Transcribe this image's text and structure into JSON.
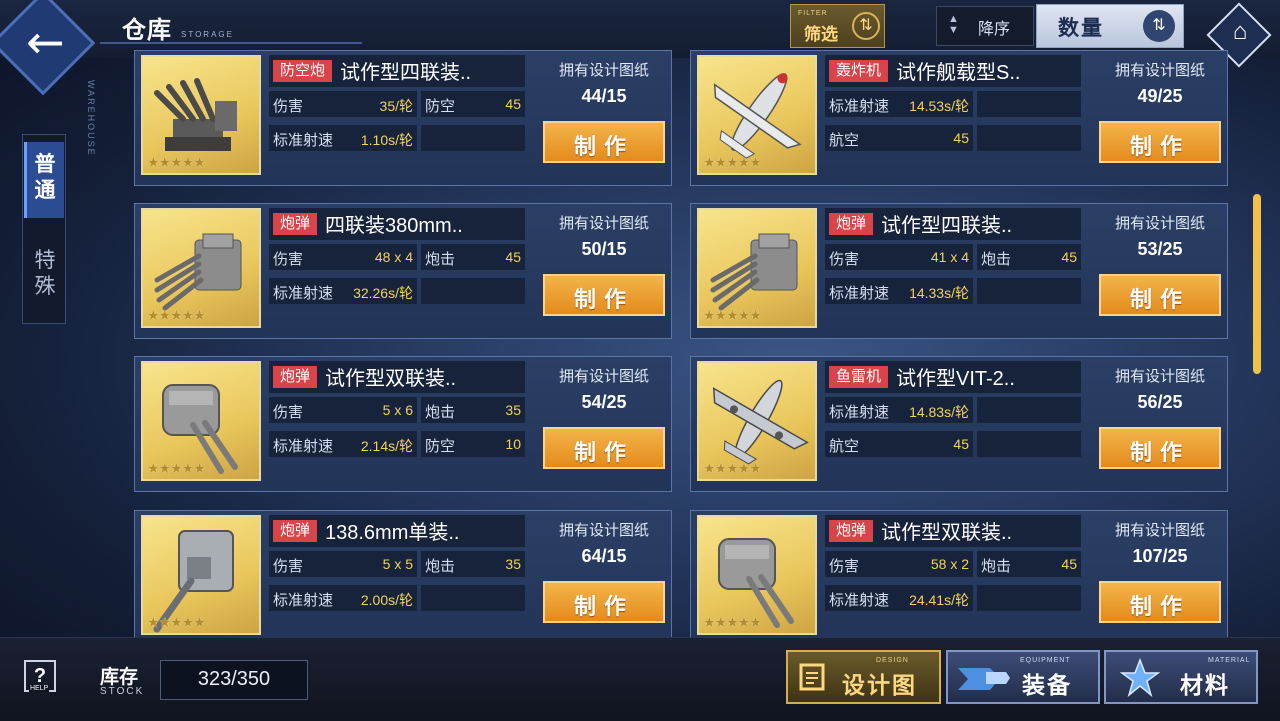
{
  "header": {
    "title": "仓库",
    "subtitle": "STORAGE",
    "filter": {
      "label": "筛选",
      "label_en": "FILTER"
    },
    "sort_order": "降序",
    "sort_field": "数量"
  },
  "sidebar": {
    "vertical_label": "WAREHOUSE",
    "tabs": [
      {
        "label": "普通",
        "selected": true
      },
      {
        "label": "特殊",
        "selected": false
      }
    ]
  },
  "bp_label": "拥有设计图纸",
  "make_label": "制作",
  "cards": [
    {
      "tag": "防空炮",
      "name": "试作型四联装..",
      "stars": "★★★★★",
      "icon": "aa-gun-icon",
      "stats": [
        {
          "label": "伤害",
          "value": "35/轮"
        },
        {
          "label": "防空",
          "value": "45"
        },
        {
          "label": "标准射速",
          "value": "1.10s/轮"
        },
        {
          "label": "",
          "value": ""
        }
      ],
      "blueprints": "44/15"
    },
    {
      "tag": "轰炸机",
      "name": "试作舰载型S..",
      "stars": "★★★★★",
      "icon": "bomber-plane-icon",
      "stats": [
        {
          "label": "标准射速",
          "value": "14.53s/轮"
        },
        {
          "label": "",
          "value": ""
        },
        {
          "label": "航空",
          "value": "45"
        },
        {
          "label": "",
          "value": ""
        }
      ],
      "blueprints": "49/25"
    },
    {
      "tag": "炮弹",
      "name": "四联装380mm..",
      "stars": "★★★★★",
      "icon": "quad-turret-icon",
      "stats": [
        {
          "label": "伤害",
          "value": "48 x 4"
        },
        {
          "label": "炮击",
          "value": "45"
        },
        {
          "label": "标准射速",
          "value": "32.26s/轮"
        },
        {
          "label": "",
          "value": ""
        }
      ],
      "blueprints": "50/15"
    },
    {
      "tag": "炮弹",
      "name": "试作型四联装..",
      "stars": "★★★★★",
      "icon": "quad-turret-icon",
      "stats": [
        {
          "label": "伤害",
          "value": "41 x 4"
        },
        {
          "label": "炮击",
          "value": "45"
        },
        {
          "label": "标准射速",
          "value": "14.33s/轮"
        },
        {
          "label": "",
          "value": ""
        }
      ],
      "blueprints": "53/25"
    },
    {
      "tag": "炮弹",
      "name": "试作型双联装..",
      "stars": "★★★★★",
      "icon": "twin-turret-icon",
      "stats": [
        {
          "label": "伤害",
          "value": "5 x 6"
        },
        {
          "label": "炮击",
          "value": "35"
        },
        {
          "label": "标准射速",
          "value": "2.14s/轮"
        },
        {
          "label": "防空",
          "value": "10"
        }
      ],
      "blueprints": "54/25"
    },
    {
      "tag": "鱼雷机",
      "name": "试作型VIT-2..",
      "stars": "★★★★★",
      "icon": "torpedo-plane-icon",
      "stats": [
        {
          "label": "标准射速",
          "value": "14.83s/轮"
        },
        {
          "label": "",
          "value": ""
        },
        {
          "label": "航空",
          "value": "45"
        },
        {
          "label": "",
          "value": ""
        }
      ],
      "blueprints": "56/25"
    },
    {
      "tag": "炮弹",
      "name": "138.6mm单装..",
      "stars": "★★★★★",
      "icon": "single-turret-icon",
      "stats": [
        {
          "label": "伤害",
          "value": "5 x 5"
        },
        {
          "label": "炮击",
          "value": "35"
        },
        {
          "label": "标准射速",
          "value": "2.00s/轮"
        },
        {
          "label": "",
          "value": ""
        }
      ],
      "blueprints": "64/15"
    },
    {
      "tag": "炮弹",
      "name": "试作型双联装..",
      "stars": "★★★★★",
      "icon": "twin-turret-icon",
      "stats": [
        {
          "label": "伤害",
          "value": "58 x 2"
        },
        {
          "label": "炮击",
          "value": "45"
        },
        {
          "label": "标准射速",
          "value": "24.41s/轮"
        },
        {
          "label": "",
          "value": ""
        }
      ],
      "blueprints": "107/25"
    }
  ],
  "footer": {
    "help_label": "HELP",
    "stock_label": "库存",
    "stock_label_en": "STOCK",
    "stock_value": "323/350",
    "buttons": [
      {
        "label": "设计图",
        "label_en": "DESIGN",
        "active": true
      },
      {
        "label": "装备",
        "label_en": "EQUIPMENT",
        "active": false
      },
      {
        "label": "材料",
        "label_en": "MATERIAL",
        "active": false
      }
    ]
  },
  "colors": {
    "tag_red": "#d9434a",
    "make_orange": "#e48b1c",
    "stat_yellow": "#f3d35a",
    "panel_blue": "#2b3f66"
  }
}
